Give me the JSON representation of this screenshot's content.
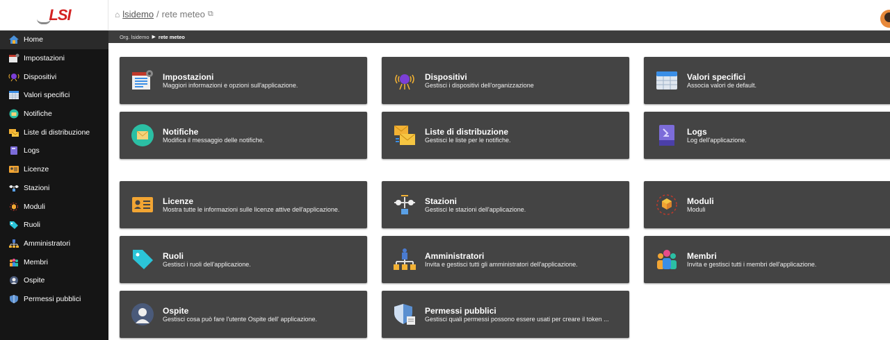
{
  "header": {
    "org_link": "lsidemo",
    "separator": " / ",
    "page": "rete meteo",
    "home_icon": "home-icon",
    "external_icon": "external-link-icon"
  },
  "subnav": {
    "org": "Org. lsidemo",
    "arrow": "▶",
    "current": "rete meteo"
  },
  "sidebar": {
    "items": [
      {
        "label": "Home",
        "icon": "home-icon"
      },
      {
        "label": "Impostazioni",
        "icon": "settings-icon"
      },
      {
        "label": "Dispositivi",
        "icon": "devices-icon"
      },
      {
        "label": "Valori specifici",
        "icon": "table-icon"
      },
      {
        "label": "Notifiche",
        "icon": "mail-icon"
      },
      {
        "label": "Liste di distribuzione",
        "icon": "mailing-list-icon"
      },
      {
        "label": "Logs",
        "icon": "log-icon"
      },
      {
        "label": "Licenze",
        "icon": "license-icon"
      },
      {
        "label": "Stazioni",
        "icon": "stations-icon"
      },
      {
        "label": "Moduli",
        "icon": "modules-icon"
      },
      {
        "label": "Ruoli",
        "icon": "tag-icon"
      },
      {
        "label": "Amministratori",
        "icon": "admin-icon"
      },
      {
        "label": "Membri",
        "icon": "members-icon"
      },
      {
        "label": "Ospite",
        "icon": "guest-icon"
      },
      {
        "label": "Permessi pubblici",
        "icon": "shield-icon"
      }
    ]
  },
  "cards": [
    {
      "title": "Impostazioni",
      "desc": "Maggiori informazioni e opzioni sull'applicazione.",
      "icon": "settings-icon"
    },
    {
      "title": "Dispositivi",
      "desc": "Gestisci i dispositivi dell'organizzazione",
      "icon": "devices-icon"
    },
    {
      "title": "Valori specifici",
      "desc": "Associa valori de default.",
      "icon": "table-icon"
    },
    {
      "title": "Notifiche",
      "desc": "Modifica il messaggio delle notifiche.",
      "icon": "mail-icon"
    },
    {
      "title": "Liste di distribuzione",
      "desc": "Gestisci le liste per le notifiche.",
      "icon": "mailing-list-icon"
    },
    {
      "title": "Logs",
      "desc": "Log dell'applicazione.",
      "icon": "log-icon"
    },
    {
      "title": "Licenze",
      "desc": "Mostra tutte le informazioni sulle licenze attive dell'applicazione.",
      "icon": "license-icon"
    },
    {
      "title": "Stazioni",
      "desc": "Gestisci le stazioni dell'applicazione.",
      "icon": "stations-icon"
    },
    {
      "title": "Moduli",
      "desc": "Moduli",
      "icon": "modules-icon"
    },
    {
      "title": "Ruoli",
      "desc": "Gestisci i ruoli dell'applicazione.",
      "icon": "tag-icon"
    },
    {
      "title": "Amministratori",
      "desc": "Invita e gestisci tutti gli amministratori dell'applicazione.",
      "icon": "admin-icon"
    },
    {
      "title": "Membri",
      "desc": "Invita e gestisci tutti i membri dell'applicazione.",
      "icon": "members-icon"
    },
    {
      "title": "Ospite",
      "desc": "Gestisci cosa può fare l'utente Ospite dell' applicazione.",
      "icon": "guest-icon"
    },
    {
      "title": "Permessi pubblici",
      "desc": "Gestisci quali permessi possono essere usati per creare il token ...",
      "icon": "shield-icon"
    }
  ],
  "colors": {
    "sidebar_bg": "#151515",
    "card_bg": "#444444",
    "subbar_bg": "#3d3d3d",
    "logo_red": "#d32222"
  }
}
